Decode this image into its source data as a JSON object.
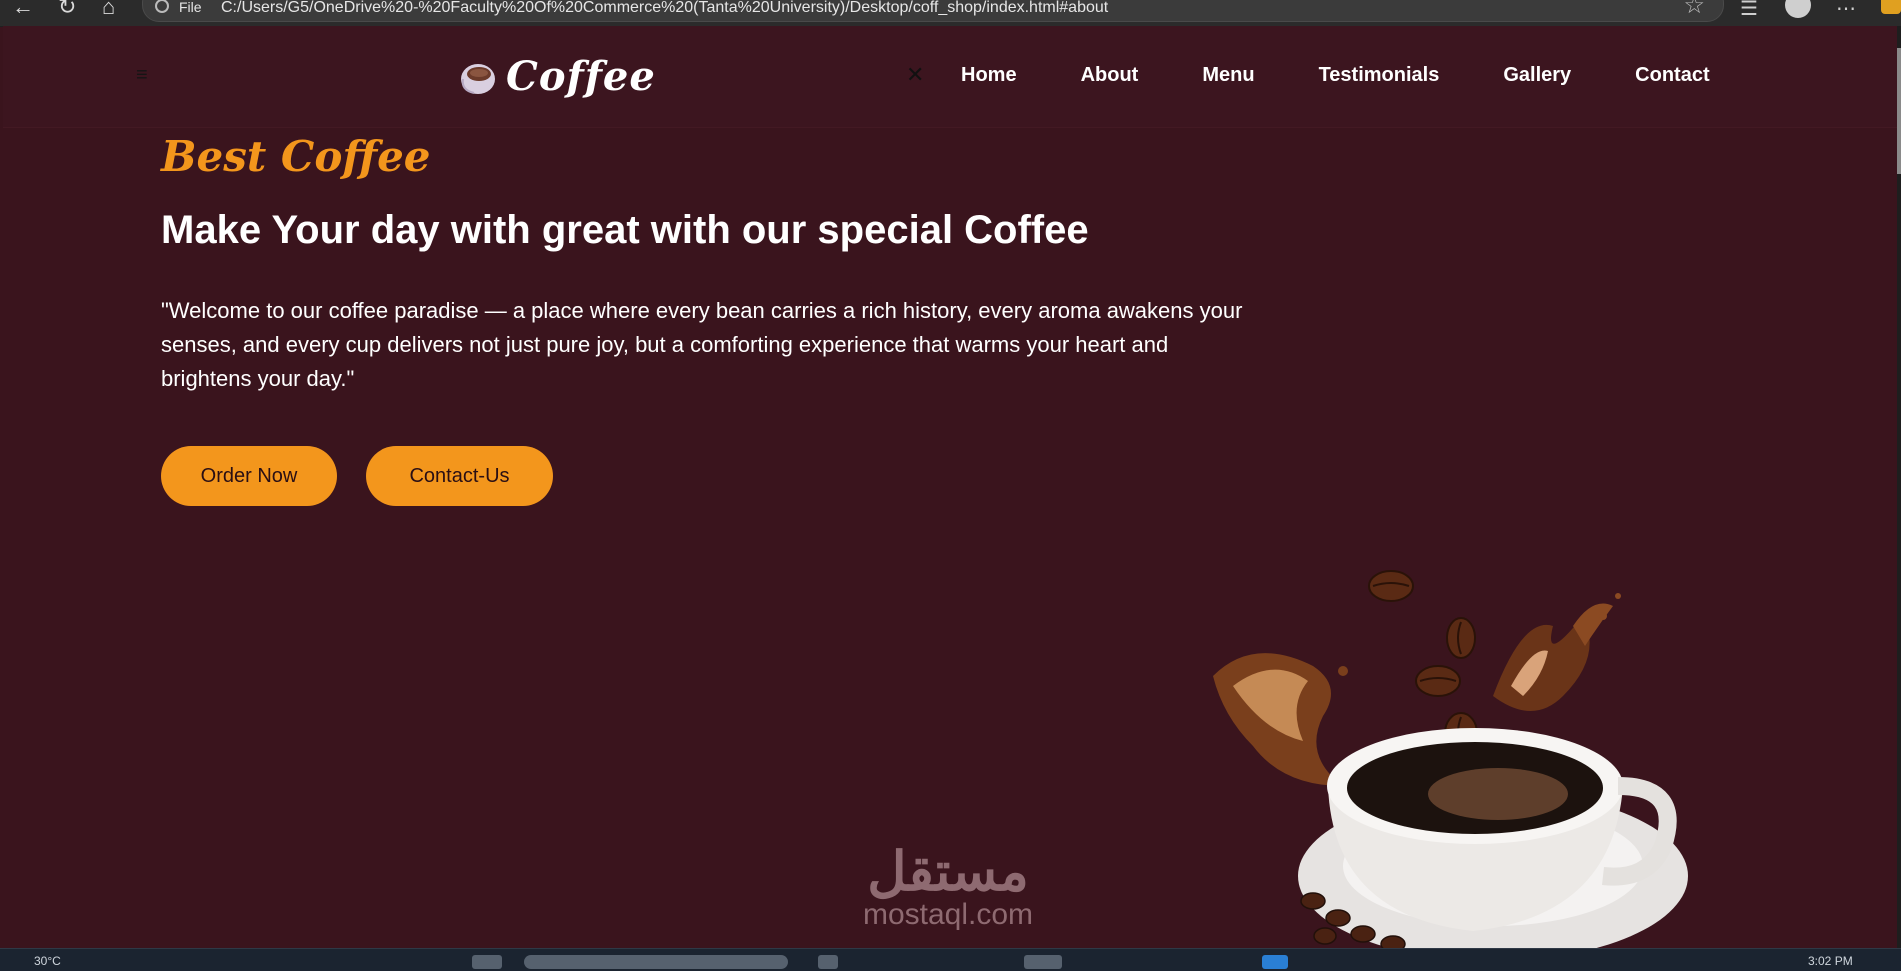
{
  "browser": {
    "url_scheme_label": "File",
    "url": "C:/Users/G5/OneDrive%20-%20Faculty%20Of%20Commerce%20(Tanta%20University)/Desktop/coff_shop/index.html#about"
  },
  "header": {
    "brand": "Coffee",
    "close_glyph": "✕",
    "menu_glyph": "≡",
    "nav": [
      "Home",
      "About",
      "Menu",
      "Testimonials",
      "Gallery",
      "Contact"
    ]
  },
  "hero": {
    "kicker": "Best Coffee",
    "title": "Make Your day with great with our special Coffee",
    "description": "\"Welcome to our coffee paradise — a place where every bean carries a rich history, every aroma awakens your senses, and every cup delivers not just pure joy, but a comforting experience that warms your heart and brightens your day.\"",
    "buttons": {
      "order": "Order Now",
      "contact": "Contact-Us"
    }
  },
  "watermark": {
    "arabic": "مستقل",
    "latin": "mostaql.com"
  },
  "taskbar": {
    "weather": "30°C",
    "clock": "3:02 PM"
  },
  "colors": {
    "background": "#3a141d",
    "accent": "#f3961c",
    "text": "#ffffff"
  },
  "icons": {
    "menu": "hamburger-icon",
    "close": "close-icon",
    "logo": "coffee-cup-icon",
    "bookmark": "star-icon"
  }
}
